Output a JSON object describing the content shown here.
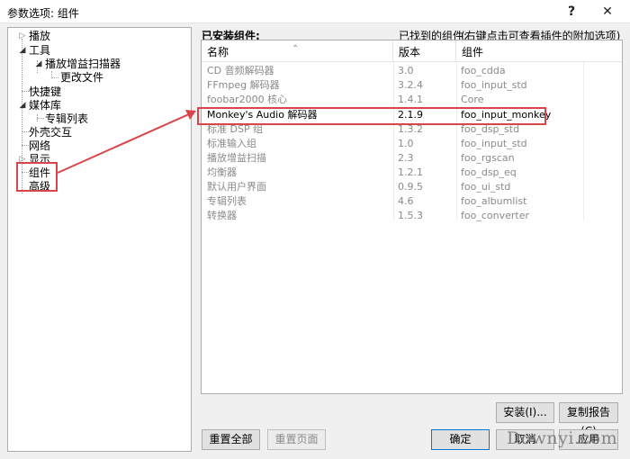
{
  "window": {
    "title": "参数选项: 组件",
    "help": "?",
    "close": "✕"
  },
  "tree": {
    "items": [
      {
        "label": "播放",
        "key": "playback"
      },
      {
        "label": "工具",
        "key": "tools"
      },
      {
        "label": "播放增益扫描器",
        "key": "replaygain"
      },
      {
        "label": "更改文件",
        "key": "change-files"
      },
      {
        "label": "快捷键",
        "key": "shortcuts"
      },
      {
        "label": "媒体库",
        "key": "media-library"
      },
      {
        "label": "专辑列表",
        "key": "album-list"
      },
      {
        "label": "外壳交互",
        "key": "shell"
      },
      {
        "label": "网络",
        "key": "network"
      },
      {
        "label": "显示",
        "key": "display"
      },
      {
        "label": "组件",
        "key": "components"
      },
      {
        "label": "高级",
        "key": "advanced"
      }
    ]
  },
  "panel": {
    "installed_label": "已安装组件:",
    "found_label": "已找到的组件:",
    "hint": "(右键点击可查看插件的附加选项)"
  },
  "list": {
    "columns": [
      "名称",
      "版本",
      "组件"
    ],
    "rows": [
      {
        "name": "CD 音频解码器",
        "version": "3.0",
        "component": "foo_cdda"
      },
      {
        "name": "FFmpeg 解码器",
        "version": "3.2.4",
        "component": "foo_input_std"
      },
      {
        "name": "foobar2000 核心",
        "version": "1.4.1",
        "component": "Core"
      },
      {
        "name": "Monkey's Audio 解码器",
        "version": "2.1.9",
        "component": "foo_input_monkey"
      },
      {
        "name": "标准 DSP 组",
        "version": "1.3.2",
        "component": "foo_dsp_std"
      },
      {
        "name": "标准输入组",
        "version": "1.0",
        "component": "foo_input_std"
      },
      {
        "name": "播放增益扫描",
        "version": "2.3",
        "component": "foo_rgscan"
      },
      {
        "name": "均衡器",
        "version": "1.2.1",
        "component": "foo_dsp_eq"
      },
      {
        "name": "默认用户界面",
        "version": "0.9.5",
        "component": "foo_ui_std"
      },
      {
        "name": "专辑列表",
        "version": "4.6",
        "component": "foo_albumlist"
      },
      {
        "name": "转换器",
        "version": "1.5.3",
        "component": "foo_converter"
      }
    ]
  },
  "buttons": {
    "install": "安装(I)...",
    "copy_report": "复制报告(C)",
    "reset_all": "重置全部",
    "reset_page": "重置页面",
    "ok": "确定",
    "cancel": "取消",
    "apply": "应用"
  },
  "watermark": "Downyi.com",
  "colors": {
    "highlight": "#d9454b",
    "primary_border": "#0078d7"
  }
}
